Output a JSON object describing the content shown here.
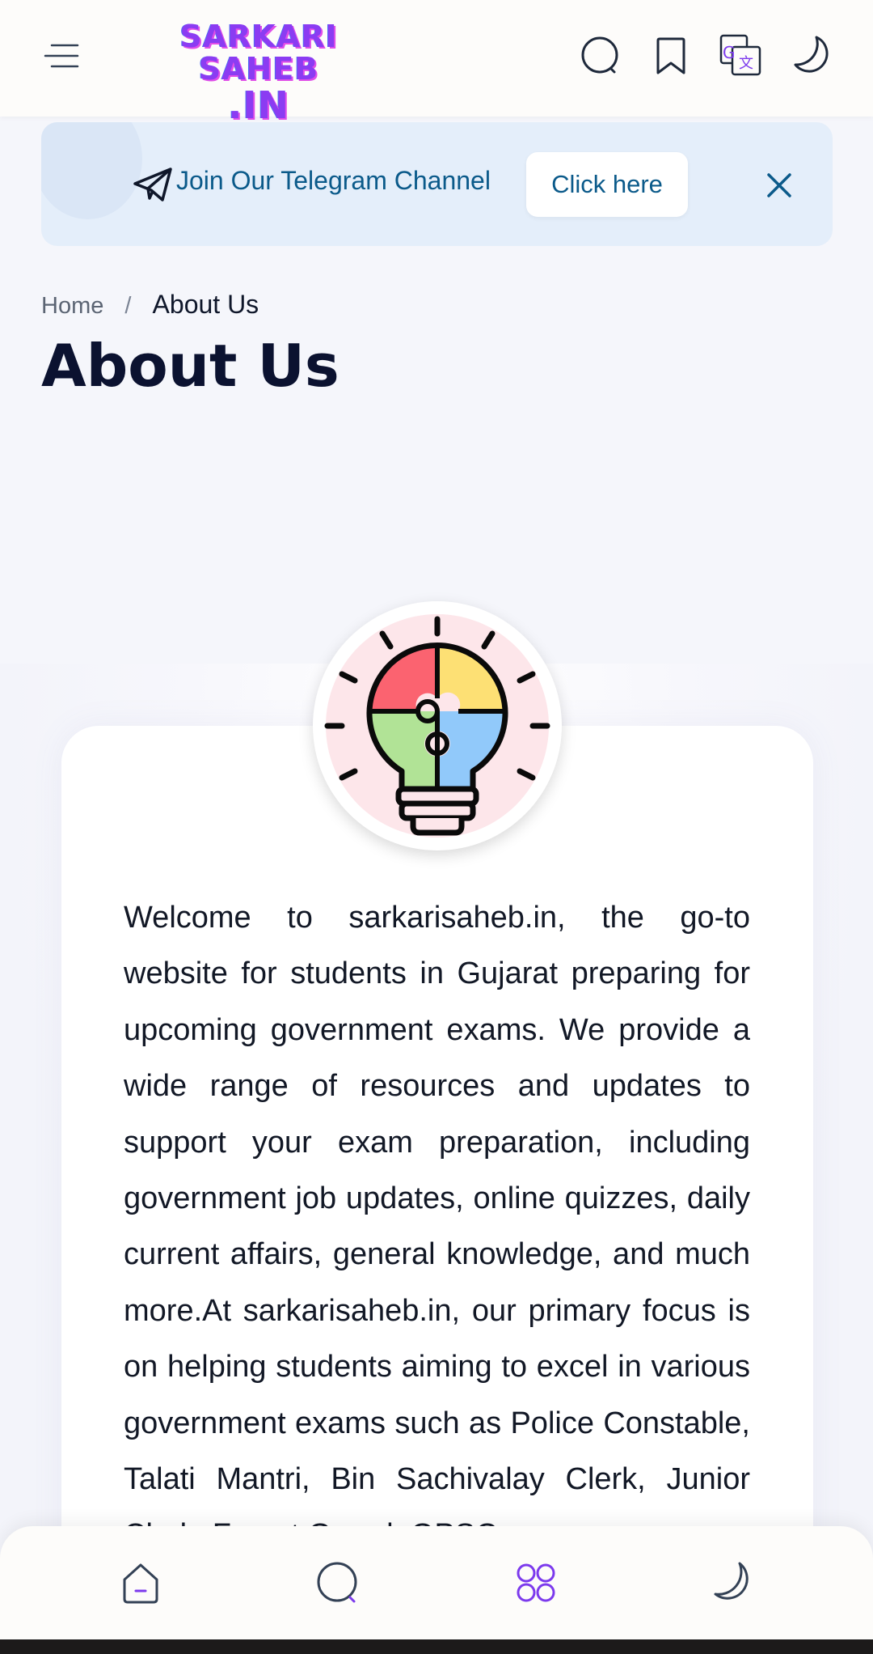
{
  "header": {
    "logo_line1": "SARKARI SAHEB",
    "logo_line2": ".IN",
    "icons": [
      "menu-icon",
      "search-icon",
      "bookmark-icon",
      "translate-icon",
      "dark-mode-icon"
    ]
  },
  "banner": {
    "text": "Join Our Telegram Channel",
    "button_label": "Click here",
    "icons": [
      "telegram-icon",
      "close-icon"
    ]
  },
  "breadcrumb": {
    "home": "Home",
    "separator": "/",
    "current": "About Us"
  },
  "page": {
    "title": "About Us",
    "body": "Welcome to sarkarisaheb.in, the go-to website for students in Gujarat preparing for upcoming government exams. We provide a wide range of resources and updates to support your exam preparation, including government job updates, online quizzes, daily current affairs, general knowledge, and much more.At sarkarisaheb.in, our primary focus is on helping students aiming to excel in various government exams such as Police Constable, Talati Mantri, Bin Sachivalay Clerk, Junior Clerk, Forest Guard, GPSC"
  },
  "bottom_nav": {
    "icons": [
      "home-icon",
      "search-icon",
      "categories-icon",
      "dark-mode-icon"
    ]
  },
  "colors": {
    "accent": "#0b5a8a",
    "banner_bg": "#e4eefa",
    "logo": "#8b3cf2",
    "title": "#0b1230"
  }
}
